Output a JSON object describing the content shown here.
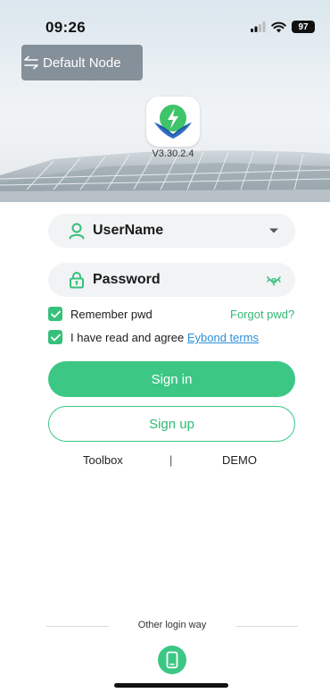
{
  "status_bar": {
    "time": "09:26",
    "battery": "97"
  },
  "header": {
    "node_label": "Default Node",
    "version": "V3.30.2.4"
  },
  "form": {
    "username_value": "UserName",
    "password_value": "Password",
    "remember_label": "Remember pwd",
    "remember_checked": true,
    "forgot_label": "Forgot pwd?",
    "agree_prefix": "I have read and agree",
    "agree_link": "Eybond terms",
    "agree_checked": true
  },
  "actions": {
    "sign_in_label": "Sign in",
    "sign_up_label": "Sign up",
    "toolbox_label": "Toolbox",
    "separator": "|",
    "demo_label": "DEMO"
  },
  "footer": {
    "other_login_label": "Other login way"
  },
  "icons": {
    "node": "swap-arrows-icon",
    "app_logo": "lightning-wings-logo",
    "username": "user-icon",
    "dropdown": "caret-down-icon",
    "password": "lock-icon",
    "show_password": "eye-closed-icon",
    "phone_login": "phone-icon"
  },
  "colors": {
    "accent": "#3cc785",
    "link": "#2d8fd6"
  }
}
